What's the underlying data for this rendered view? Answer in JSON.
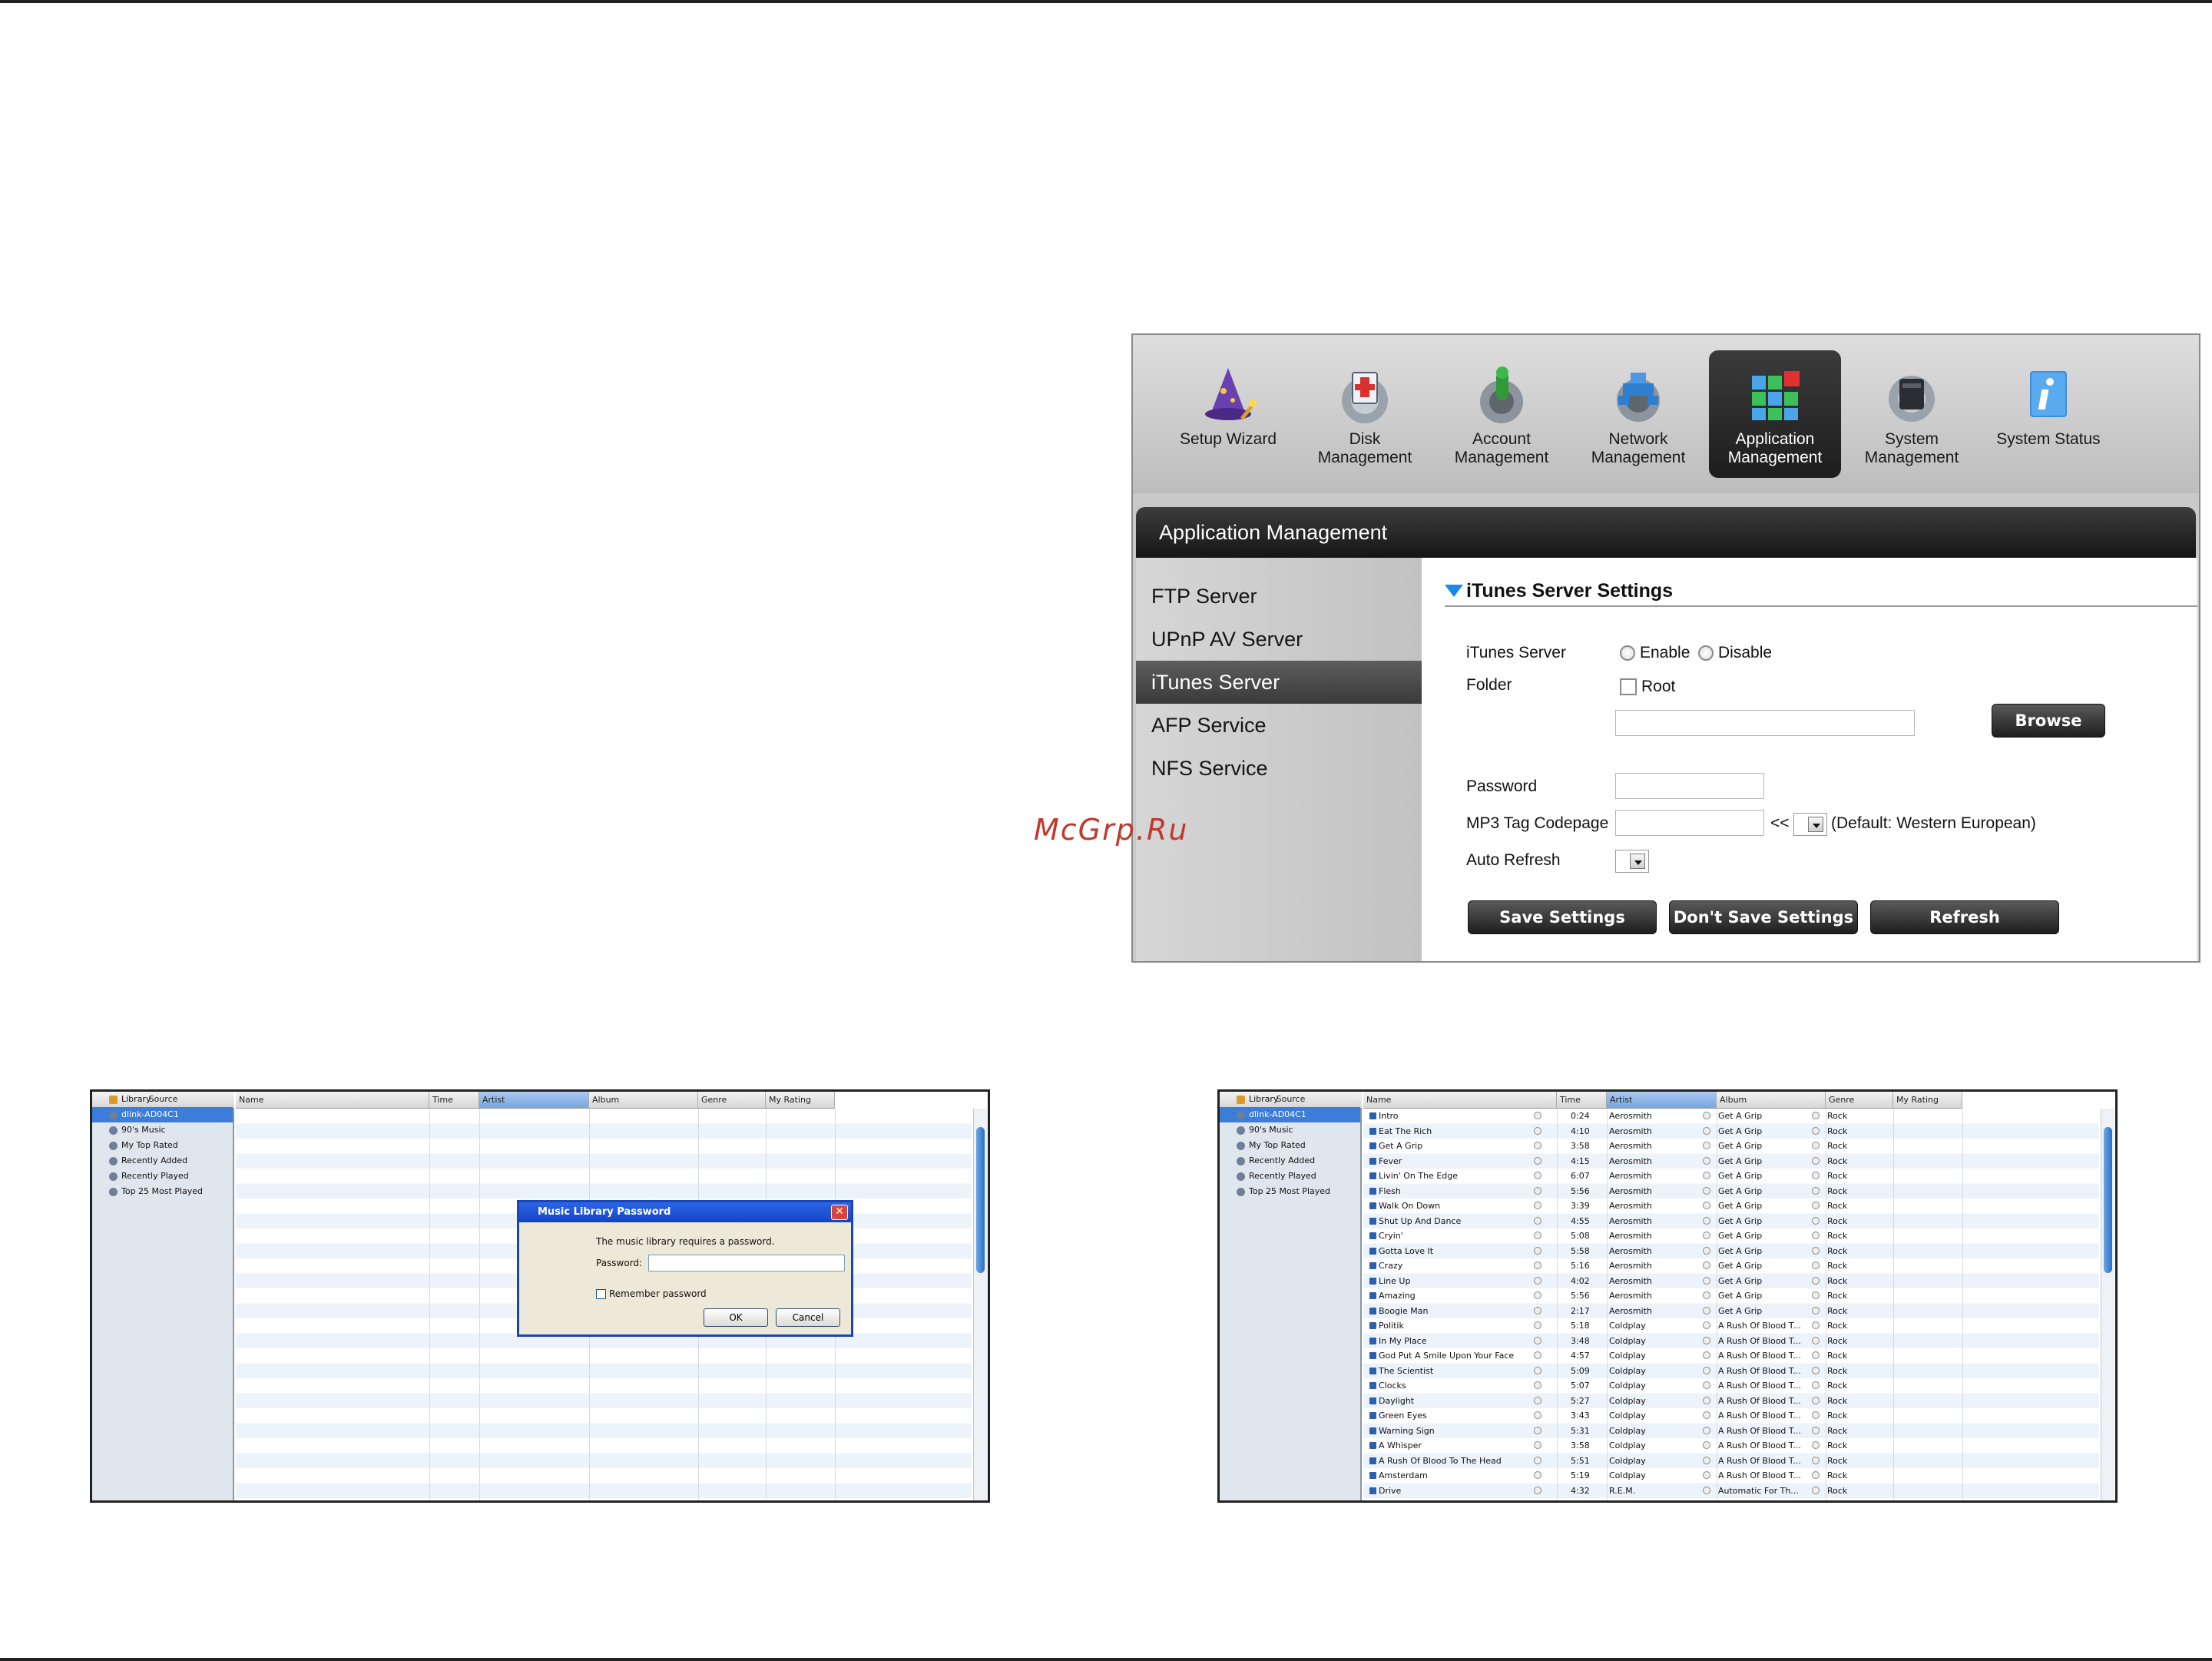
{
  "watermark": "McGrp.Ru",
  "nas": {
    "nav": [
      {
        "label": "Setup Wizard",
        "icon": "wizard-icon",
        "active": false
      },
      {
        "label": "Disk\nManagement",
        "icon": "disk-management-icon",
        "active": false
      },
      {
        "label": "Account\nManagement",
        "icon": "account-management-icon",
        "active": false
      },
      {
        "label": "Network\nManagement",
        "icon": "network-management-icon",
        "active": false
      },
      {
        "label": "Application\nManagement",
        "icon": "application-management-icon",
        "active": true
      },
      {
        "label": "System\nManagement",
        "icon": "system-management-icon",
        "active": false
      },
      {
        "label": "System Status",
        "icon": "system-status-icon",
        "active": false
      }
    ],
    "section_title": "Application Management",
    "sidebar": [
      {
        "label": "FTP Server",
        "active": false
      },
      {
        "label": "UPnP AV Server",
        "active": false
      },
      {
        "label": "iTunes Server",
        "active": true
      },
      {
        "label": "AFP Service",
        "active": false
      },
      {
        "label": "NFS Service",
        "active": false
      }
    ],
    "settings": {
      "heading": "iTunes Server Settings",
      "itunes_server_label": "iTunes Server",
      "enable_label": "Enable",
      "disable_label": "Disable",
      "folder_label": "Folder",
      "root_label": "Root",
      "browse_label": "Browse",
      "password_label": "Password",
      "codepage_label": "MP3 Tag Codepage",
      "codepage_arrows": "<<",
      "codepage_default": "(Default: Western European)",
      "auto_refresh_label": "Auto Refresh",
      "save_label": "Save Settings",
      "dont_save_label": "Don't Save Settings",
      "refresh_label": "Refresh"
    }
  },
  "itunes_common": {
    "source_header": "Source",
    "sources": [
      "Library",
      "dlink-AD04C1",
      "90's Music",
      "My Top Rated",
      "Recently Added",
      "Recently Played",
      "Top 25 Most Played"
    ],
    "columns": [
      "Name",
      "Time",
      "Artist",
      "Album",
      "Genre",
      "My Rating"
    ]
  },
  "dialog": {
    "title": "Music Library Password",
    "message": "The music library requires a password.",
    "password_label": "Password:",
    "remember_label": "Remember password",
    "ok_label": "OK",
    "cancel_label": "Cancel"
  },
  "tracks": [
    {
      "name": "Intro",
      "time": "0:24",
      "artist": "Aerosmith",
      "album": "Get A Grip",
      "genre": "Rock"
    },
    {
      "name": "Eat The Rich",
      "time": "4:10",
      "artist": "Aerosmith",
      "album": "Get A Grip",
      "genre": "Rock"
    },
    {
      "name": "Get A Grip",
      "time": "3:58",
      "artist": "Aerosmith",
      "album": "Get A Grip",
      "genre": "Rock"
    },
    {
      "name": "Fever",
      "time": "4:15",
      "artist": "Aerosmith",
      "album": "Get A Grip",
      "genre": "Rock"
    },
    {
      "name": "Livin' On The Edge",
      "time": "6:07",
      "artist": "Aerosmith",
      "album": "Get A Grip",
      "genre": "Rock"
    },
    {
      "name": "Flesh",
      "time": "5:56",
      "artist": "Aerosmith",
      "album": "Get A Grip",
      "genre": "Rock"
    },
    {
      "name": "Walk On Down",
      "time": "3:39",
      "artist": "Aerosmith",
      "album": "Get A Grip",
      "genre": "Rock"
    },
    {
      "name": "Shut Up And Dance",
      "time": "4:55",
      "artist": "Aerosmith",
      "album": "Get A Grip",
      "genre": "Rock"
    },
    {
      "name": "Cryin'",
      "time": "5:08",
      "artist": "Aerosmith",
      "album": "Get A Grip",
      "genre": "Rock"
    },
    {
      "name": "Gotta Love It",
      "time": "5:58",
      "artist": "Aerosmith",
      "album": "Get A Grip",
      "genre": "Rock"
    },
    {
      "name": "Crazy",
      "time": "5:16",
      "artist": "Aerosmith",
      "album": "Get A Grip",
      "genre": "Rock"
    },
    {
      "name": "Line Up",
      "time": "4:02",
      "artist": "Aerosmith",
      "album": "Get A Grip",
      "genre": "Rock"
    },
    {
      "name": "Amazing",
      "time": "5:56",
      "artist": "Aerosmith",
      "album": "Get A Grip",
      "genre": "Rock"
    },
    {
      "name": "Boogie Man",
      "time": "2:17",
      "artist": "Aerosmith",
      "album": "Get A Grip",
      "genre": "Rock"
    },
    {
      "name": "Politik",
      "time": "5:18",
      "artist": "Coldplay",
      "album": "A Rush Of Blood T...",
      "genre": "Rock"
    },
    {
      "name": "In My Place",
      "time": "3:48",
      "artist": "Coldplay",
      "album": "A Rush Of Blood T...",
      "genre": "Rock"
    },
    {
      "name": "God Put A Smile Upon Your Face",
      "time": "4:57",
      "artist": "Coldplay",
      "album": "A Rush Of Blood T...",
      "genre": "Rock"
    },
    {
      "name": "The Scientist",
      "time": "5:09",
      "artist": "Coldplay",
      "album": "A Rush Of Blood T...",
      "genre": "Rock"
    },
    {
      "name": "Clocks",
      "time": "5:07",
      "artist": "Coldplay",
      "album": "A Rush Of Blood T...",
      "genre": "Rock"
    },
    {
      "name": "Daylight",
      "time": "5:27",
      "artist": "Coldplay",
      "album": "A Rush Of Blood T...",
      "genre": "Rock"
    },
    {
      "name": "Green Eyes",
      "time": "3:43",
      "artist": "Coldplay",
      "album": "A Rush Of Blood T...",
      "genre": "Rock"
    },
    {
      "name": "Warning Sign",
      "time": "5:31",
      "artist": "Coldplay",
      "album": "A Rush Of Blood T...",
      "genre": "Rock"
    },
    {
      "name": "A Whisper",
      "time": "3:58",
      "artist": "Coldplay",
      "album": "A Rush Of Blood T...",
      "genre": "Rock"
    },
    {
      "name": "A Rush Of Blood To The Head",
      "time": "5:51",
      "artist": "Coldplay",
      "album": "A Rush Of Blood T...",
      "genre": "Rock"
    },
    {
      "name": "Amsterdam",
      "time": "5:19",
      "artist": "Coldplay",
      "album": "A Rush Of Blood T...",
      "genre": "Rock"
    },
    {
      "name": "Drive",
      "time": "4:32",
      "artist": "R.E.M.",
      "album": "Automatic For Th...",
      "genre": "Rock"
    }
  ]
}
